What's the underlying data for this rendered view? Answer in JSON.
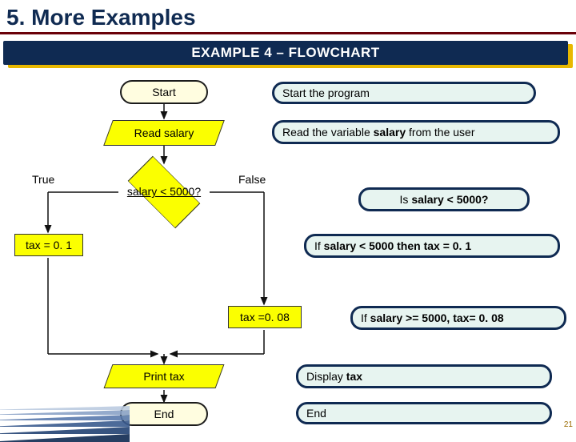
{
  "header": {
    "title": "5. More Examples",
    "banner": "EXAMPLE 4 – FLOWCHART"
  },
  "flow": {
    "start": "Start",
    "read": "Read salary",
    "decision": "salary < 5000?",
    "trueLabel": "True",
    "falseLabel": "False",
    "leftProcess": "tax = 0. 1",
    "rightProcess": "tax =0. 08",
    "print": "Print tax",
    "end": "End"
  },
  "annotations": {
    "a1": "Start the program",
    "a2_pre": "Read the variable ",
    "a2_b": "salary",
    "a2_post": " from the user",
    "a3_pre": "Is ",
    "a3_b": "salary < 5000?",
    "a4_pre": "If ",
    "a4_b": "salary < 5000 then tax = 0. 1",
    "a5_pre": "If ",
    "a5_b": "salary >= 5000, tax= 0. 08",
    "a6_pre": "Display ",
    "a6_b": "tax",
    "a7": "End"
  },
  "pagenum": "21",
  "chart_data": {
    "type": "flowchart",
    "nodes": [
      {
        "id": "start",
        "kind": "terminator",
        "label": "Start"
      },
      {
        "id": "read",
        "kind": "io",
        "label": "Read salary"
      },
      {
        "id": "dec",
        "kind": "decision",
        "label": "salary < 5000?"
      },
      {
        "id": "taxTrue",
        "kind": "process",
        "label": "tax = 0. 1"
      },
      {
        "id": "taxFalse",
        "kind": "process",
        "label": "tax =0. 08"
      },
      {
        "id": "print",
        "kind": "io",
        "label": "Print tax"
      },
      {
        "id": "end",
        "kind": "terminator",
        "label": "End"
      }
    ],
    "edges": [
      {
        "from": "start",
        "to": "read"
      },
      {
        "from": "read",
        "to": "dec"
      },
      {
        "from": "dec",
        "to": "taxTrue",
        "label": "True"
      },
      {
        "from": "dec",
        "to": "taxFalse",
        "label": "False"
      },
      {
        "from": "taxTrue",
        "to": "print"
      },
      {
        "from": "taxFalse",
        "to": "print"
      },
      {
        "from": "print",
        "to": "end"
      }
    ],
    "annotations": [
      "Start the program",
      "Read the variable salary from the user",
      "Is salary < 5000?",
      "If salary < 5000 then tax = 0. 1",
      "If salary >= 5000, tax= 0. 08",
      "Display tax",
      "End"
    ]
  }
}
